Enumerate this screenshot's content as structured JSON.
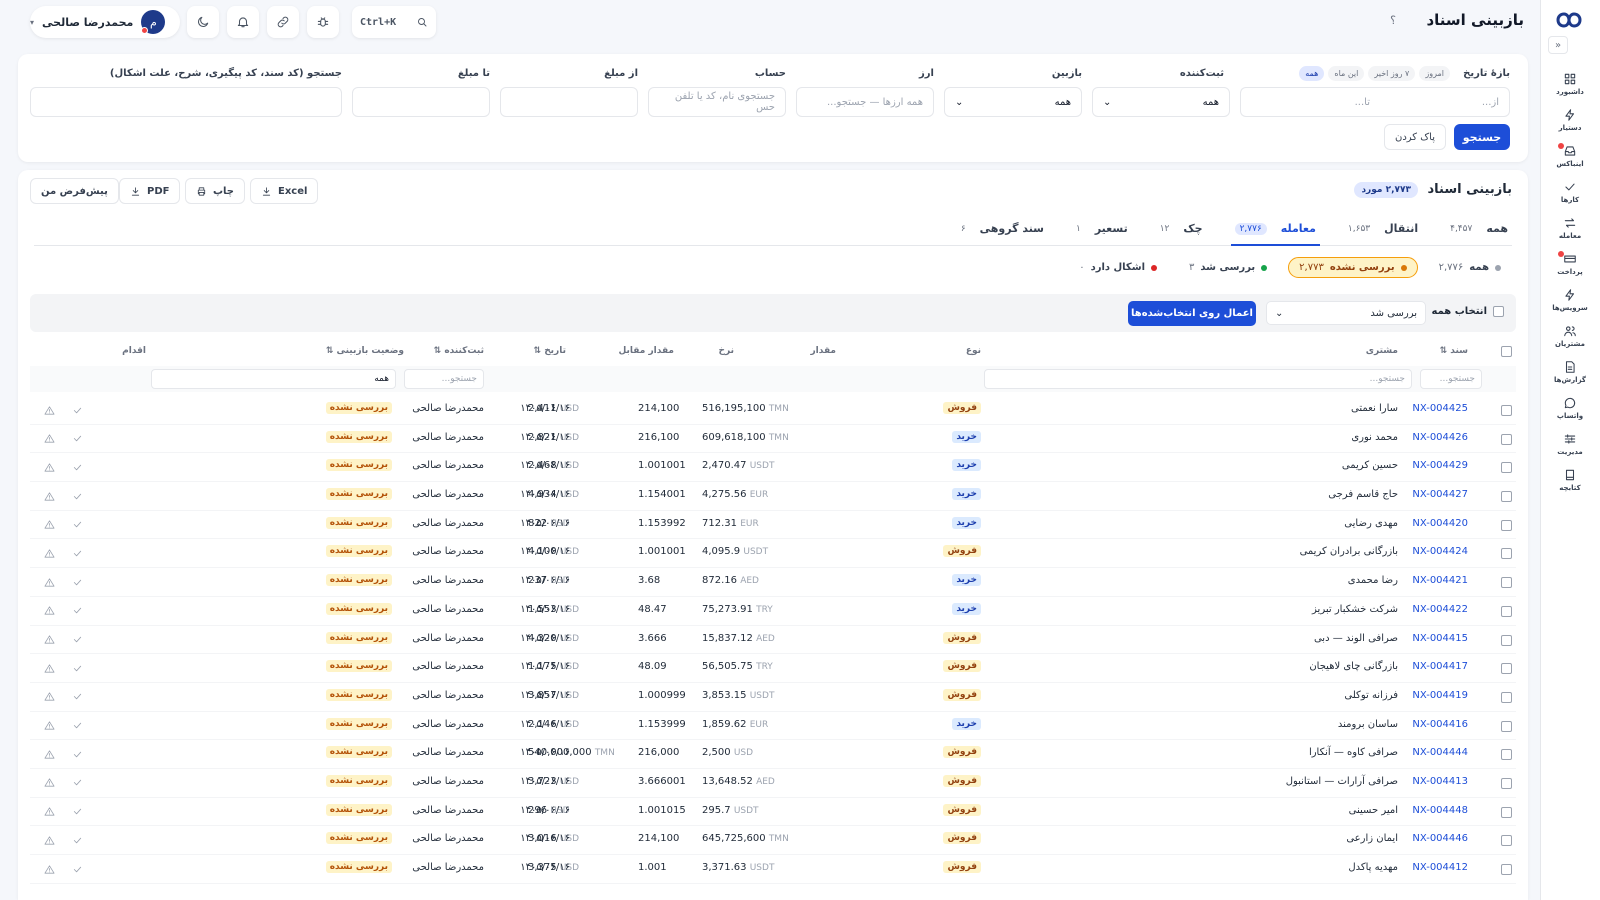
{
  "topbar": {
    "title": "بازبینی اسناد",
    "help": "؟",
    "user": {
      "name": "محمدرضا صالحی",
      "initial": "م"
    },
    "search_shortcut": "Ctrl+K"
  },
  "sidebar": {
    "collapse": "»",
    "items": [
      {
        "label": "داشبورد",
        "icon": "grid-icon"
      },
      {
        "label": "دستیار",
        "icon": "bolt-icon"
      },
      {
        "label": "اینباکس",
        "icon": "inbox-icon",
        "dot": true
      },
      {
        "label": "کارها",
        "icon": "check-icon"
      },
      {
        "label": "معامله",
        "icon": "swap-icon"
      },
      {
        "label": "پرداخت",
        "icon": "payment-icon",
        "dot": true
      },
      {
        "label": "سرویس‌ها",
        "icon": "bolt-icon"
      },
      {
        "label": "مشتریان",
        "icon": "users-icon"
      },
      {
        "label": "گزارش‌ها",
        "icon": "report-icon"
      },
      {
        "label": "واتساپ",
        "icon": "chat-icon"
      },
      {
        "label": "مدیریت",
        "icon": "sliders-icon"
      },
      {
        "label": "کتابچه",
        "icon": "book-icon"
      }
    ]
  },
  "filters": {
    "date_range_label": "بازهٔ تاریخ",
    "quick_chips": [
      "امروز",
      "۷ روز اخیر",
      "این ماه",
      "همه"
    ],
    "date_from_placeholder": "از...",
    "date_to_placeholder": "تا...",
    "registrar_label": "ثبت‌کننده",
    "registrar_value": "همه",
    "reviewer_label": "بازبین",
    "reviewer_value": "همه",
    "currency_label": "ارز",
    "currency_placeholder": "همه ارزها — جستجو...",
    "account_label": "حساب",
    "account_placeholder": "جستجوی نام، کد یا تلفن حس",
    "amount_from_label": "از مبلغ",
    "amount_to_label": "تا مبلغ",
    "search_label": "جستجو (کد سند، کد پیگیری، شرح، علت اشکال)",
    "search_button": "جستجو",
    "clear_button": "پاک کردن"
  },
  "main": {
    "title": "بازبینی اسناد",
    "count_badge": "۲,۷۷۳ مورد",
    "actions": {
      "excel": "Excel",
      "print": "چاپ",
      "pdf": "PDF",
      "default": "پیش‌فرض من"
    },
    "tabs": [
      {
        "label": "همه",
        "count": "۴,۴۵۷"
      },
      {
        "label": "انتقال",
        "count": "۱,۶۵۳"
      },
      {
        "label": "معامله",
        "count": "۲,۷۷۶",
        "active": true
      },
      {
        "label": "چک",
        "count": "۱۲"
      },
      {
        "label": "تسعیر",
        "count": "۱"
      },
      {
        "label": "سند گروهی",
        "count": "۶"
      }
    ],
    "status_chips": [
      {
        "label": "همه",
        "count": "۲,۷۷۶",
        "color": "#9ca3af"
      },
      {
        "label": "بررسی نشده",
        "count": "۲,۷۷۳",
        "color": "#d97706",
        "active": true
      },
      {
        "label": "بررسی شد",
        "count": "۳",
        "color": "#16a34a"
      },
      {
        "label": "اشکال دارد",
        "count": "۰",
        "color": "#dc2626"
      }
    ],
    "bulk": {
      "select_all": "انتخاب همه",
      "status_value": "بررسی شد",
      "apply": "اعمال روی انتخاب‌شده‌ها"
    }
  },
  "table": {
    "headers": {
      "doc": "سند ⇅",
      "customer": "مشتری",
      "type": "نوع",
      "amount": "مقدار",
      "rate": "نرخ",
      "counter": "مقدار مقابل",
      "date": "تاریخ ⇅",
      "registrar": "ثبت‌کننده ⇅",
      "status": "وضعیت بازبینی ⇅",
      "action": "اقدام"
    },
    "filter_row": {
      "doc": "جستجو...",
      "customer": "جستجو...",
      "registrar": "جستجو...",
      "status": "همه"
    },
    "rows": [
      {
        "doc": "NX-004425",
        "customer": "سارا نعمتی",
        "type": "فروش",
        "kind": "sell",
        "amount": "516,195,100",
        "amount_unit": "TMN",
        "rate": "214,100",
        "counter": "2,411",
        "counter_unit": "USD",
        "date": "۱۴۰۵/۰۶/۱۶",
        "registrar": "محمدرضا صالحی",
        "status": "بررسی نشده"
      },
      {
        "doc": "NX-004426",
        "customer": "محمد نوری",
        "type": "خرید",
        "kind": "buy",
        "amount": "609,618,100",
        "amount_unit": "TMN",
        "rate": "216,100",
        "counter": "2,821",
        "counter_unit": "USD",
        "date": "۱۴۰۵/۰۶/۱۶",
        "registrar": "محمدرضا صالحی",
        "status": "بررسی نشده"
      },
      {
        "doc": "NX-004429",
        "customer": "حسین کریمی",
        "type": "خرید",
        "kind": "buy",
        "amount": "2,470.47",
        "amount_unit": "USDT",
        "rate": "1.001001",
        "counter": "2,468",
        "counter_unit": "USD",
        "date": "۱۴۰۵/۰۶/۱۶",
        "registrar": "محمدرضا صالحی",
        "status": "بررسی نشده"
      },
      {
        "doc": "NX-004427",
        "customer": "حاج قاسم فرجی",
        "type": "خرید",
        "kind": "buy",
        "amount": "4,275.56",
        "amount_unit": "EUR",
        "rate": "1.154001",
        "counter": "4,934",
        "counter_unit": "USD",
        "date": "۱۴۰۵/۰۶/۱۶",
        "registrar": "محمدرضا صالحی",
        "status": "بررسی نشده"
      },
      {
        "doc": "NX-004420",
        "customer": "مهدی رضایی",
        "type": "خرید",
        "kind": "buy",
        "amount": "712.31",
        "amount_unit": "EUR",
        "rate": "1.153992",
        "counter": "822",
        "counter_unit": "USD",
        "date": "۱۴۰۵/۰۶/۱۶",
        "registrar": "محمدرضا صالحی",
        "status": "بررسی نشده"
      },
      {
        "doc": "NX-004424",
        "customer": "بازرگانی برادران کریمی",
        "type": "فروش",
        "kind": "sell",
        "amount": "4,095.9",
        "amount_unit": "USDT",
        "rate": "1.001001",
        "counter": "4,100",
        "counter_unit": "USD",
        "date": "۱۴۰۵/۰۶/۱۶",
        "registrar": "محمدرضا صالحی",
        "status": "بررسی نشده"
      },
      {
        "doc": "NX-004421",
        "customer": "رضا محمدی",
        "type": "خرید",
        "kind": "buy",
        "amount": "872.16",
        "amount_unit": "AED",
        "rate": "3.68",
        "counter": "237",
        "counter_unit": "USD",
        "date": "۱۴۰۵/۰۶/۱۶",
        "registrar": "محمدرضا صالحی",
        "status": "بررسی نشده"
      },
      {
        "doc": "NX-004422",
        "customer": "شرکت خشکبار تبریز",
        "type": "خرید",
        "kind": "buy",
        "amount": "75,273.91",
        "amount_unit": "TRY",
        "rate": "48.47",
        "counter": "1,553",
        "counter_unit": "USD",
        "date": "۱۴۰۵/۰۶/۱۶",
        "registrar": "محمدرضا صالحی",
        "status": "بررسی نشده"
      },
      {
        "doc": "NX-004415",
        "customer": "صرافی الوند — دبی",
        "type": "فروش",
        "kind": "sell",
        "amount": "15,837.12",
        "amount_unit": "AED",
        "rate": "3.666",
        "counter": "4,320",
        "counter_unit": "USD",
        "date": "۱۴۰۵/۰۶/۱۶",
        "registrar": "محمدرضا صالحی",
        "status": "بررسی نشده"
      },
      {
        "doc": "NX-004417",
        "customer": "بازرگانی چای لاهیجان",
        "type": "فروش",
        "kind": "sell",
        "amount": "56,505.75",
        "amount_unit": "TRY",
        "rate": "48.09",
        "counter": "1,175",
        "counter_unit": "USD",
        "date": "۱۴۰۵/۰۶/۱۶",
        "registrar": "محمدرضا صالحی",
        "status": "بررسی نشده"
      },
      {
        "doc": "NX-004419",
        "customer": "فرزانه توکلی",
        "type": "فروش",
        "kind": "sell",
        "amount": "3,853.15",
        "amount_unit": "USDT",
        "rate": "1.000999",
        "counter": "3,857",
        "counter_unit": "USD",
        "date": "۱۴۰۵/۰۶/۱۶",
        "registrar": "محمدرضا صالحی",
        "status": "بررسی نشده"
      },
      {
        "doc": "NX-004416",
        "customer": "ساسان برومند",
        "type": "خرید",
        "kind": "buy",
        "amount": "1,859.62",
        "amount_unit": "EUR",
        "rate": "1.153999",
        "counter": "2,146",
        "counter_unit": "USD",
        "date": "۱۴۰۵/۰۶/۱۶",
        "registrar": "محمدرضا صالحی",
        "status": "بررسی نشده"
      },
      {
        "doc": "NX-004444",
        "customer": "صرافی کاوه — آنکارا",
        "type": "فروش",
        "kind": "sell",
        "amount": "2,500",
        "amount_unit": "USD",
        "rate": "216,000",
        "counter": "540,000,000",
        "counter_unit": "TMN",
        "date": "۱۴۰۵/۰۶/۱۶",
        "registrar": "محمدرضا صالحی",
        "status": "بررسی نشده"
      },
      {
        "doc": "NX-004413",
        "customer": "صرافی آرارات — استانبول",
        "type": "فروش",
        "kind": "sell",
        "amount": "13,648.52",
        "amount_unit": "AED",
        "rate": "3.666001",
        "counter": "3,723",
        "counter_unit": "USD",
        "date": "۱۴۰۵/۰۶/۱۶",
        "registrar": "محمدرضا صالحی",
        "status": "بررسی نشده"
      },
      {
        "doc": "NX-004448",
        "customer": "امیر حسینی",
        "type": "فروش",
        "kind": "sell",
        "amount": "295.7",
        "amount_unit": "USDT",
        "rate": "1.001015",
        "counter": "296",
        "counter_unit": "USD",
        "date": "۱۴۰۵/۰۶/۱۶",
        "registrar": "محمدرضا صالحی",
        "status": "بررسی نشده"
      },
      {
        "doc": "NX-004446",
        "customer": "ایمان زارعی",
        "type": "فروش",
        "kind": "sell",
        "amount": "645,725,600",
        "amount_unit": "TMN",
        "rate": "214,100",
        "counter": "3,016",
        "counter_unit": "USD",
        "date": "۱۴۰۵/۰۶/۱۶",
        "registrar": "محمدرضا صالحی",
        "status": "بررسی نشده"
      },
      {
        "doc": "NX-004412",
        "customer": "مهدیه پاکدل",
        "type": "فروش",
        "kind": "sell",
        "amount": "3,371.63",
        "amount_unit": "USDT",
        "rate": "1.001",
        "counter": "3,375",
        "counter_unit": "USD",
        "date": "۱۴۰۵/۰۶/۱۶",
        "registrar": "محمدرضا صالحی",
        "status": "بررسی نشده"
      }
    ]
  }
}
